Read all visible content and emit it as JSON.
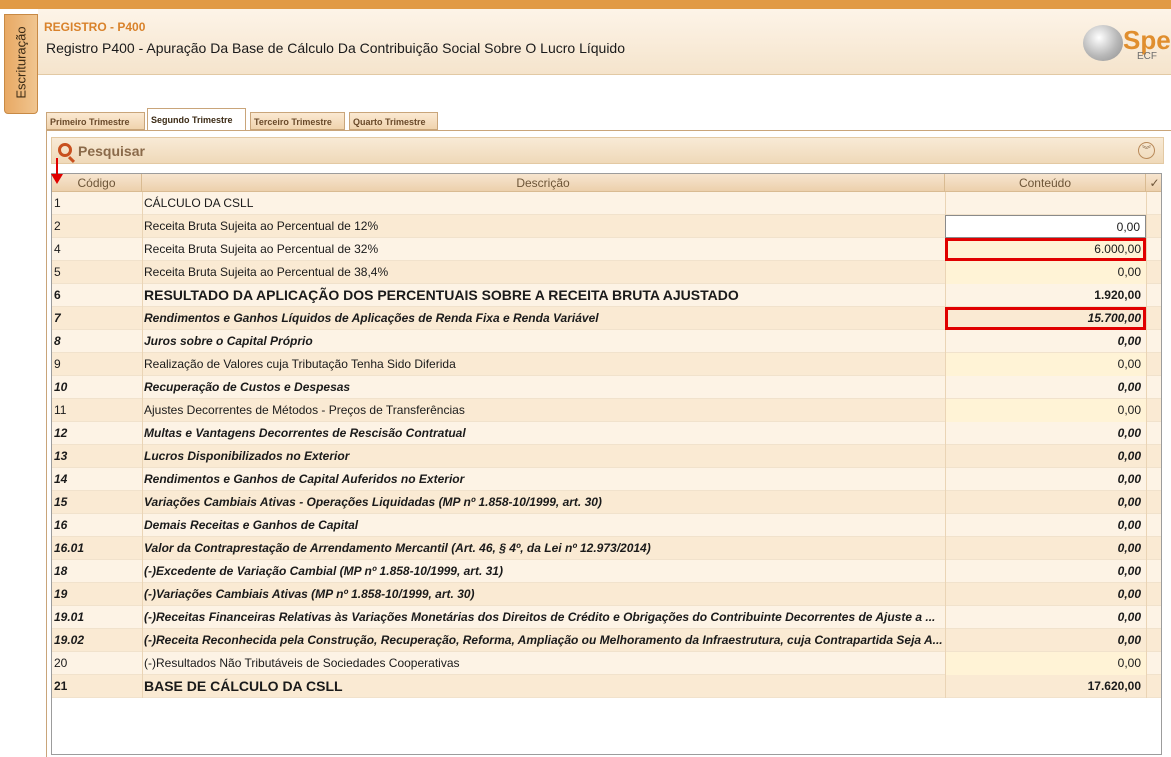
{
  "sidebar": {
    "tab_label": "Escrituração"
  },
  "header": {
    "code": "REGISTRO - P400",
    "title": "Registro P400 - Apuração Da Base de Cálculo Da Contribuição Social Sobre O Lucro Líquido",
    "logo_word": "Spe",
    "logo_sub": "ECF"
  },
  "tabs": [
    {
      "label": "Primeiro Trimestre",
      "active": false
    },
    {
      "label": "Segundo Trimestre",
      "active": true
    },
    {
      "label": "Terceiro Trimestre",
      "active": false
    },
    {
      "label": "Quarto Trimestre",
      "active": false
    }
  ],
  "search": {
    "label": "Pesquisar"
  },
  "grid": {
    "columns": {
      "code": "Código",
      "desc": "Descrição",
      "value": "Conteúdo",
      "check": "✓"
    },
    "rows": [
      {
        "code": "1",
        "desc": "CÁLCULO DA CSLL",
        "value": "",
        "style": "normal"
      },
      {
        "code": "2",
        "desc": "Receita Bruta Sujeita ao Percentual de 12%",
        "value": "0,00",
        "style": "focused"
      },
      {
        "code": "4",
        "desc": "Receita Bruta Sujeita ao Percentual de 32%",
        "value": "6.000,00",
        "style": "editable",
        "highlight": true
      },
      {
        "code": "5",
        "desc": "Receita Bruta Sujeita ao Percentual de 38,4%",
        "value": "0,00",
        "style": "editable"
      },
      {
        "code": "6",
        "desc": "RESULTADO DA APLICAÇÃO DOS PERCENTUAIS SOBRE A RECEITA BRUTA AJUSTADO",
        "value": "1.920,00",
        "style": "bold-large"
      },
      {
        "code": "7",
        "desc": "Rendimentos e Ganhos Líquidos de Aplicações de Renda Fixa e Renda Variável",
        "value": "15.700,00",
        "style": "bold-italic",
        "highlight": true
      },
      {
        "code": "8",
        "desc": "Juros sobre o Capital Próprio",
        "value": "0,00",
        "style": "bold-italic"
      },
      {
        "code": "9",
        "desc": "Realização de Valores cuja Tributação Tenha Sido Diferida",
        "value": "0,00",
        "style": "editable"
      },
      {
        "code": "10",
        "desc": "Recuperação de Custos e Despesas",
        "value": "0,00",
        "style": "bold-italic"
      },
      {
        "code": "11",
        "desc": "Ajustes Decorrentes de Métodos - Preços de Transferências",
        "value": "0,00",
        "style": "editable"
      },
      {
        "code": "12",
        "desc": "Multas e Vantagens Decorrentes de Rescisão Contratual",
        "value": "0,00",
        "style": "bold-italic"
      },
      {
        "code": "13",
        "desc": "Lucros Disponibilizados no Exterior",
        "value": "0,00",
        "style": "bold-italic"
      },
      {
        "code": "14",
        "desc": "Rendimentos e Ganhos de Capital Auferidos no Exterior",
        "value": "0,00",
        "style": "bold-italic"
      },
      {
        "code": "15",
        "desc": "Variações Cambiais Ativas - Operações Liquidadas (MP nº 1.858-10/1999, art. 30)",
        "value": "0,00",
        "style": "bold-italic"
      },
      {
        "code": "16",
        "desc": "Demais Receitas e Ganhos de Capital",
        "value": "0,00",
        "style": "bold-italic"
      },
      {
        "code": "16.01",
        "desc": "Valor da Contraprestação de Arrendamento Mercantil (Art. 46, § 4º, da Lei nº 12.973/2014)",
        "value": "0,00",
        "style": "bold-italic"
      },
      {
        "code": "18",
        "desc": "(-)Excedente de Variação Cambial (MP nº 1.858-10/1999, art. 31)",
        "value": "0,00",
        "style": "bold-italic"
      },
      {
        "code": "19",
        "desc": "(-)Variações Cambiais Ativas (MP nº 1.858-10/1999, art. 30)",
        "value": "0,00",
        "style": "bold-italic"
      },
      {
        "code": "19.01",
        "desc": "(-)Receitas Financeiras Relativas às Variações Monetárias dos Direitos de Crédito e Obrigações do Contribuinte Decorrentes de Ajuste a ...",
        "value": "0,00",
        "style": "bold-italic"
      },
      {
        "code": "19.02",
        "desc": "(-)Receita Reconhecida pela Construção, Recuperação, Reforma, Ampliação ou Melhoramento da Infraestrutura, cuja Contrapartida Seja A...",
        "value": "0,00",
        "style": "bold-italic"
      },
      {
        "code": "20",
        "desc": "(-)Resultados Não Tributáveis de Sociedades Cooperativas",
        "value": "0,00",
        "style": "editable"
      },
      {
        "code": "21",
        "desc": "BASE DE CÁLCULO DA CSLL",
        "value": "17.620,00",
        "style": "bold-large"
      }
    ]
  },
  "colors": {
    "accent": "#e19a45",
    "highlight": "#e00000",
    "row_odd": "#fdf3e5",
    "row_even": "#faead3",
    "editable": "#fff3d6"
  }
}
